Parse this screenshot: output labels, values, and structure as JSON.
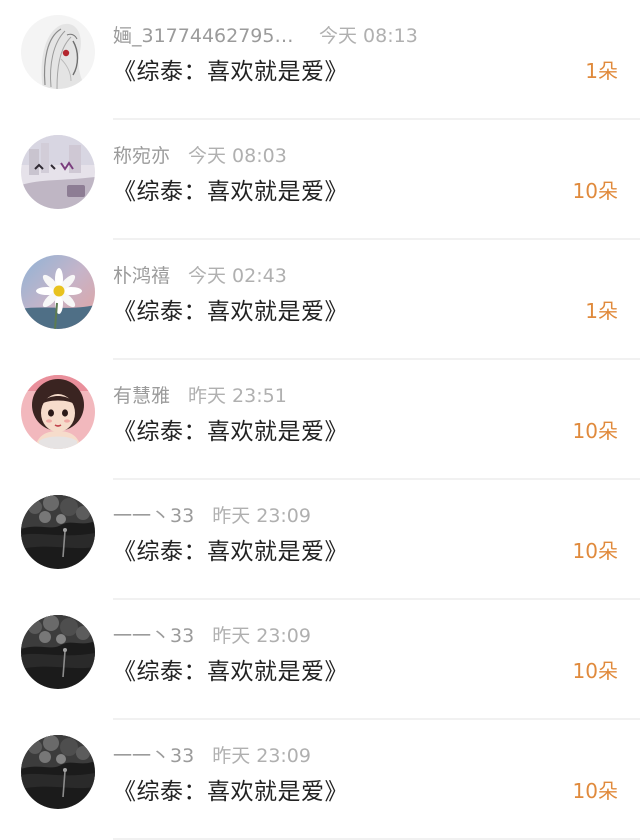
{
  "rows": [
    {
      "name": "婳_317744627957…",
      "time": "今天 08:13",
      "title": "《综泰：喜欢就是爱》",
      "gift": "1朵",
      "avatar_icon": "sketch-girl-avatar"
    },
    {
      "name": "称宛亦",
      "time": "今天 08:03",
      "title": "《综泰：喜欢就是爱》",
      "gift": "10朵",
      "avatar_icon": "pastel-scene-avatar"
    },
    {
      "name": "朴鸿禧",
      "time": "今天 02:43",
      "title": "《综泰：喜欢就是爱》",
      "gift": "1朵",
      "avatar_icon": "daisy-flower-avatar"
    },
    {
      "name": "有慧雅",
      "time": "昨天 23:51",
      "title": "《综泰：喜欢就是爱》",
      "gift": "10朵",
      "avatar_icon": "cartoon-girl-avatar"
    },
    {
      "name": "一一丶33",
      "time": "昨天 23:09",
      "title": "《综泰：喜欢就是爱》",
      "gift": "10朵",
      "avatar_icon": "monochrome-tree-avatar"
    },
    {
      "name": "一一丶33",
      "time": "昨天 23:09",
      "title": "《综泰：喜欢就是爱》",
      "gift": "10朵",
      "avatar_icon": "monochrome-tree-avatar"
    },
    {
      "name": "一一丶33",
      "time": "昨天 23:09",
      "title": "《综泰：喜欢就是爱》",
      "gift": "10朵",
      "avatar_icon": "monochrome-tree-avatar"
    }
  ],
  "colors": {
    "name": "#9b9b9b",
    "time": "#b0b0b0",
    "title": "#222222",
    "gift": "#e08a3c",
    "divider": "#f1f1f1"
  }
}
